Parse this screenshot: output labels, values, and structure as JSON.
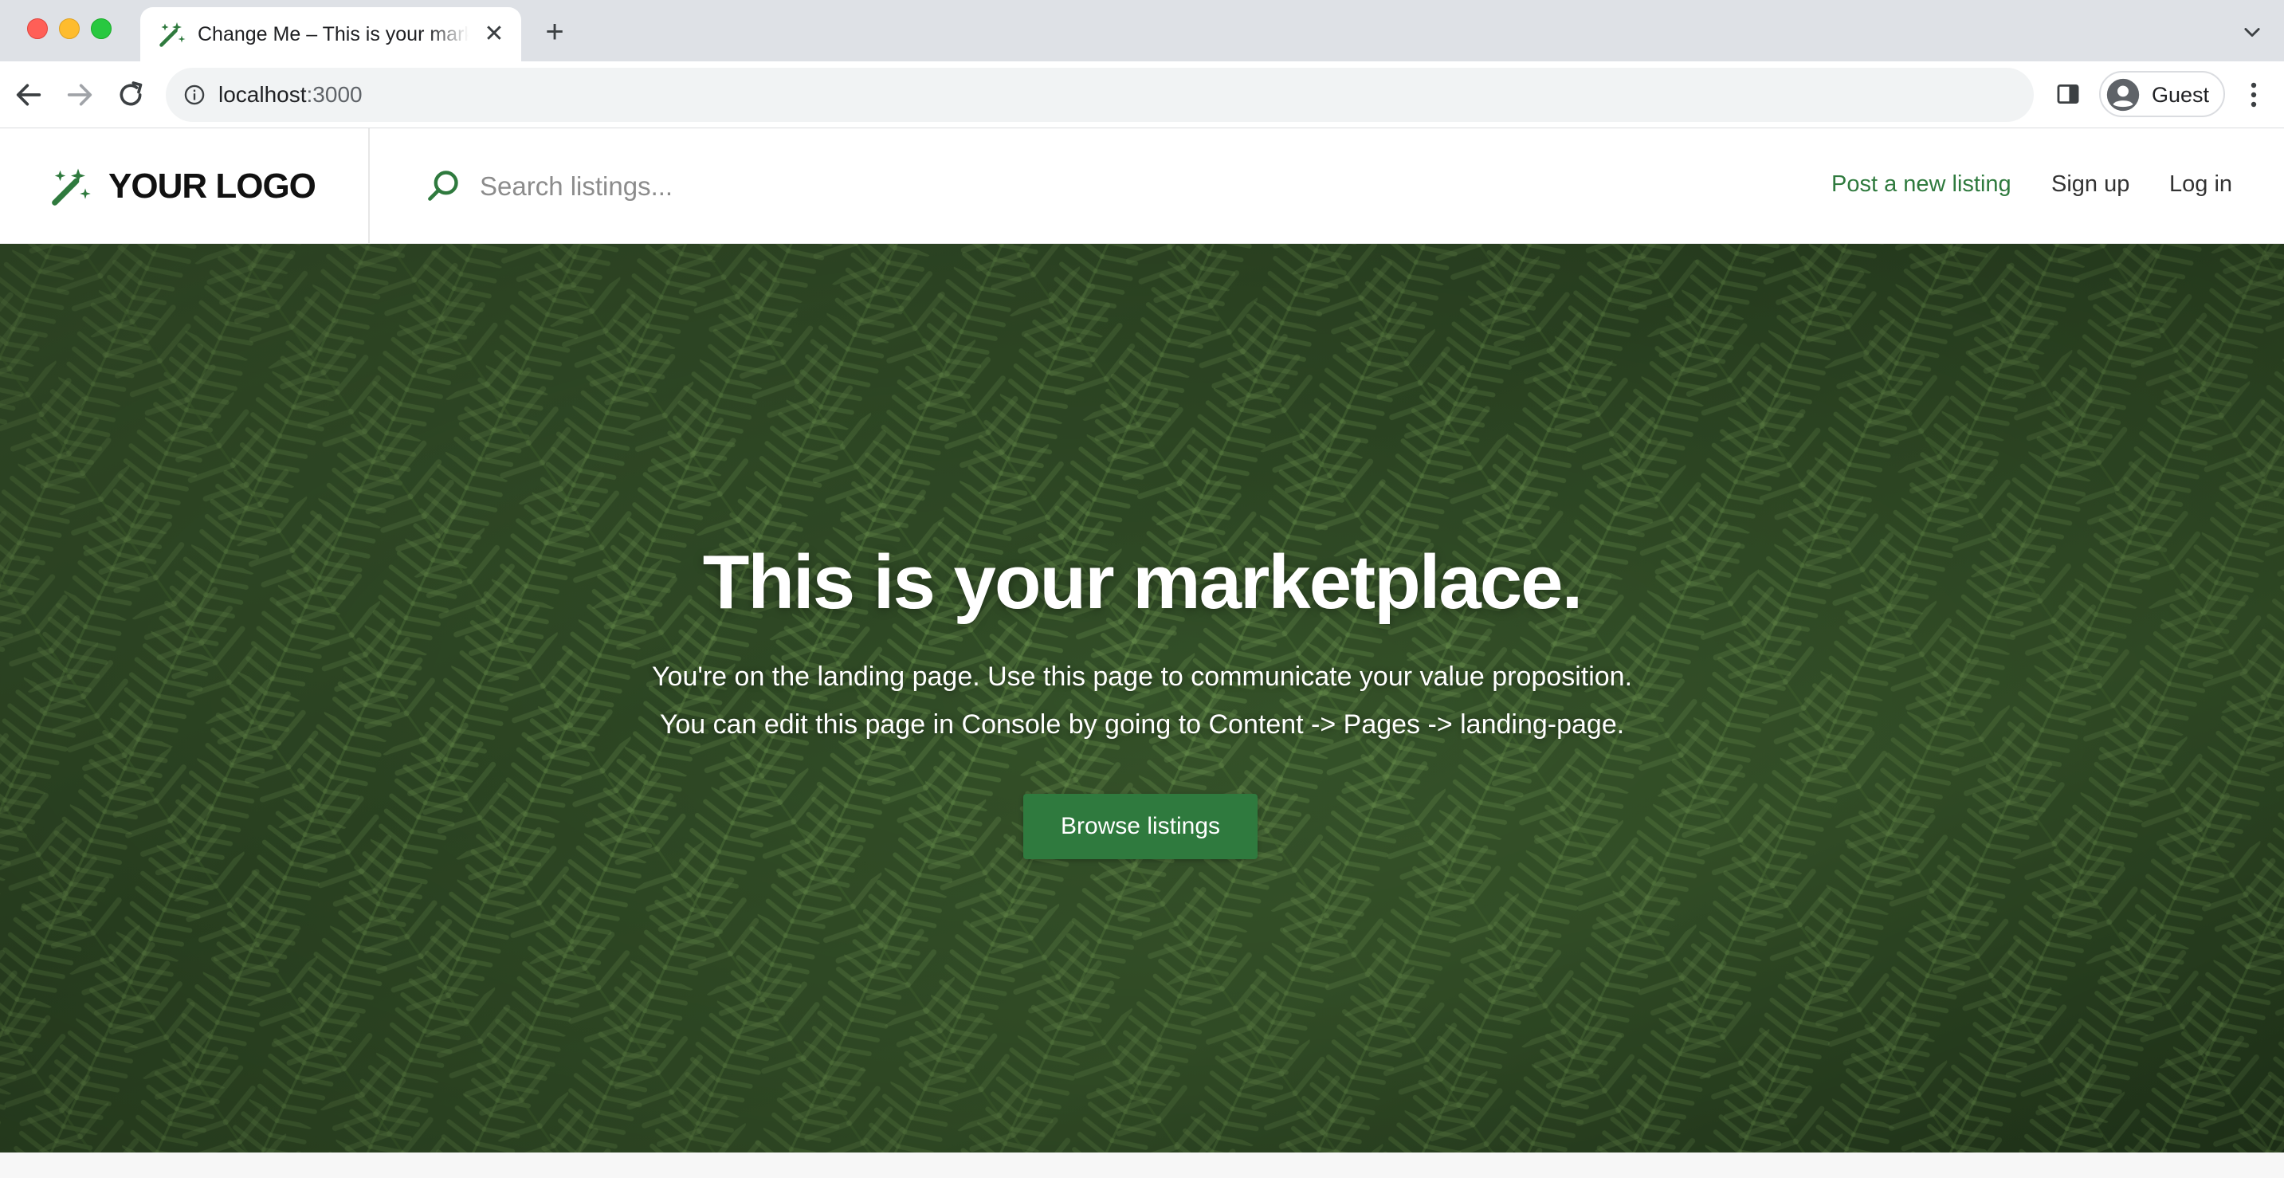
{
  "browser": {
    "tab_title": "Change Me – This is your marketplace.",
    "tab_close": "✕",
    "new_tab": "+",
    "url_host": "localhost",
    "url_port": ":3000",
    "profile_label": "Guest",
    "icons": [
      "back-arrow-icon",
      "forward-arrow-icon",
      "reload-icon",
      "site-info-icon",
      "side-panel-icon",
      "profile-avatar-icon",
      "more-menu-icon",
      "tab-search-chevron-icon"
    ]
  },
  "header": {
    "logo_text": "YOUR LOGO",
    "search_placeholder": "Search listings...",
    "nav": {
      "post_listing": "Post a new listing",
      "sign_up": "Sign up",
      "log_in": "Log in"
    }
  },
  "hero": {
    "title": "This is your marketplace.",
    "subtitle_line1": "You're on the landing page. Use this page to communicate your value proposition.",
    "subtitle_line2": "You can edit this page in Console by going to Content -> Pages -> landing-page.",
    "cta_label": "Browse listings"
  },
  "colors": {
    "brand_green": "#2f7a3e",
    "tabstrip_bg": "#dee1e6",
    "omnibox_bg": "#f1f3f4"
  }
}
